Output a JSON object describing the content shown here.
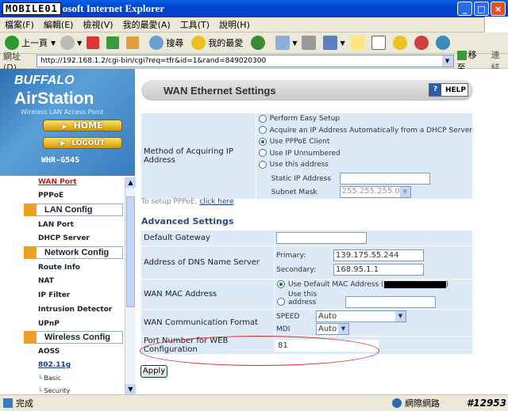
{
  "window": {
    "logo": "MOBILE01",
    "title": "osoft Internet Explorer",
    "min": "_",
    "max": "□",
    "close": "×"
  },
  "menu": [
    "檔案(F)",
    "編輯(E)",
    "檢視(V)",
    "我的最愛(A)",
    "工具(T)",
    "說明(H)"
  ],
  "toolbar": {
    "back": "上一頁",
    "search": "搜尋",
    "favorites": "我的最愛"
  },
  "address": {
    "label": "網址(D)",
    "url": "http://192.168.1.2/cgi-bin/cgi?req=tfr&id=1&rand=849020300",
    "go": "移至",
    "links": "連結"
  },
  "sidebar": {
    "brand1": "BUFFALO",
    "brand2": "AirStation",
    "brand3": "Wireless LAN Access Point",
    "home": "HOME",
    "logout": "LOGOUT",
    "model": "WHR-G54S",
    "links": [
      "WAN Port",
      "PPPoE"
    ],
    "sections": [
      "LAN Config",
      "Network Config",
      "Wireless Config"
    ],
    "lan_links": [
      "LAN Port",
      "DHCP Server"
    ],
    "net_links": [
      "Route Info",
      "NAT",
      "IP Filter",
      "Intrusion Detector",
      "UPnP"
    ],
    "wl_links": [
      "AOSS",
      "802.11g",
      "Basic",
      "Security"
    ]
  },
  "header": {
    "title": "WAN Ethernet Settings",
    "help": "HELP"
  },
  "method": {
    "label": "Method of Acquiring IP Address",
    "options": [
      "Perform Easy Setup",
      "Acquire an IP Address Automatically from a DHCP Server",
      "Use PPPoE Client",
      "Use IP Unnumbered",
      "Use this address"
    ],
    "static_ip_label": "Static IP Address",
    "subnet_label": "Subnet Mask",
    "subnet_value": "255.255.255.0"
  },
  "pppoe": {
    "text": "To setup PPPoE, ",
    "link": "click here"
  },
  "advanced": {
    "title": "Advanced Settings",
    "gateway_label": "Default Gateway",
    "dns_label": "Address of DNS Name Server",
    "primary_label": "Primary:",
    "primary_value": "139.175.55.244",
    "secondary_label": "Secondary:",
    "secondary_value": "168.95.1.1",
    "mac_label": "WAN MAC Address",
    "mac_default": "Use Default MAC Address (",
    "mac_default_end": ")",
    "mac_custom": "Use this address",
    "comm_label": "WAN Communication Format",
    "speed_label": "SPEED",
    "speed_value": "Auto",
    "mdi_label": "MDI",
    "mdi_value": "Auto",
    "port_label": "Port Number for WEB Configuration",
    "port_value": "81"
  },
  "apply": "Apply",
  "status": {
    "left": "完成",
    "right": "網際網路",
    "watermark": "#12953"
  }
}
